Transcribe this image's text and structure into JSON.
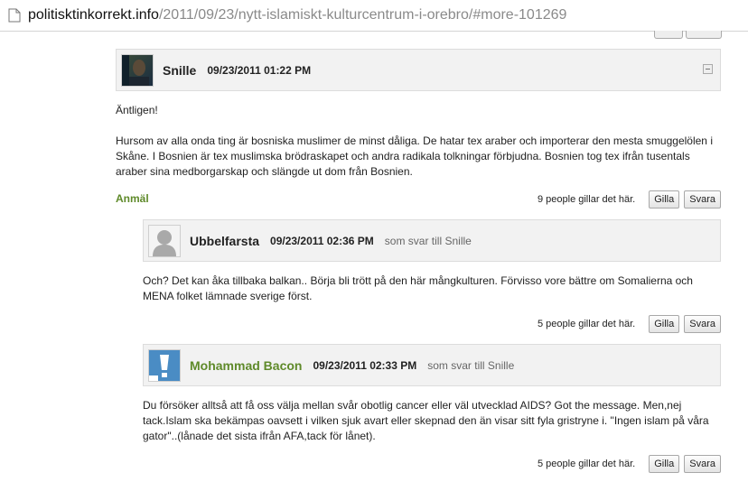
{
  "browser": {
    "url_domain": "politisktinkorrekt.info",
    "url_path": "/2011/09/23/nytt-islamiskt-kulturcentrum-i-orebro/#more-101269"
  },
  "comments": [
    {
      "author": "Snille",
      "date": "09/23/2011 01:22 PM",
      "paragraphs": [
        "Äntligen!",
        "Hursom av alla onda ting är bosniska muslimer de minst dåliga. De hatar tex araber och importerar den mesta smuggelölen i Skåne. I Bosnien är tex muslimska brödraskapet och andra radikala tolkningar förbjudna. Bosnien tog tex ifrån tusentals araber sina medborgarskap och slängde ut dom från Bosnien."
      ],
      "report_label": "Anmäl",
      "likes": "9 people gillar det här.",
      "like_button": "Gilla",
      "reply_button": "Svara"
    },
    {
      "author": "Ubbelfarsta",
      "date": "09/23/2011 02:36 PM",
      "reply_to": "som svar till Snille",
      "paragraphs": [
        "Och? Det kan åka tillbaka balkan.. Börja bli trött på den här mångkulturen. Förvisso vore bättre om Somalierna och MENA folket lämnade sverige först."
      ],
      "likes": "5 people gillar det här.",
      "like_button": "Gilla",
      "reply_button": "Svara"
    },
    {
      "author": "Mohammad Bacon",
      "date": "09/23/2011 02:33 PM",
      "reply_to": "som svar till Snille",
      "paragraphs": [
        "Du försöker alltså att få oss välja mellan svår obotlig cancer eller väl utvecklad AIDS?  Got the message. Men,nej tack.Islam ska bekämpas oavsett i vilken sjuk avart eller skepnad den än visar sitt fyla gristryne i. \"Ingen islam på våra gator\"..(lånade det sista ifrån AFA,tack för lånet)."
      ],
      "likes": "5 people gillar det här.",
      "like_button": "Gilla",
      "reply_button": "Svara"
    }
  ]
}
